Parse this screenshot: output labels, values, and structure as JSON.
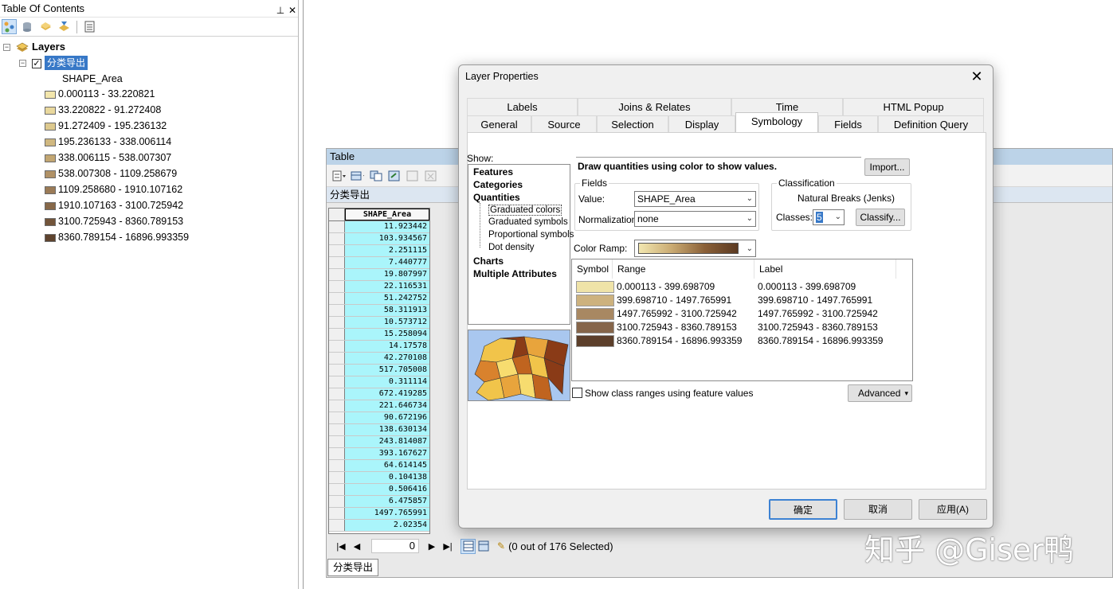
{
  "toc": {
    "title": "Table Of Contents",
    "pin_icon": "pin-icon",
    "close_icon": "close-icon",
    "tree": {
      "root_label": "Layers",
      "layer_name": "分类导出",
      "field_name": "SHAPE_Area",
      "legend": [
        {
          "label": "0.000113 - 33.220821",
          "color": "#f3e6ac"
        },
        {
          "label": "33.220822 - 91.272408",
          "color": "#e9d89d"
        },
        {
          "label": "91.272409 - 195.236132",
          "color": "#ddc98e"
        },
        {
          "label": "195.236133 - 338.006114",
          "color": "#d0b880"
        },
        {
          "label": "338.006115 - 538.007307",
          "color": "#c2a672"
        },
        {
          "label": "538.007308 - 1109.258679",
          "color": "#b09166"
        },
        {
          "label": "1109.258680 - 1910.107162",
          "color": "#9b7b57"
        },
        {
          "label": "1910.107163 - 3100.725942",
          "color": "#876849"
        },
        {
          "label": "3100.725943 - 8360.789153",
          "color": "#72543a"
        },
        {
          "label": "8360.789154 - 16896.993359",
          "color": "#5e432e"
        }
      ]
    }
  },
  "table": {
    "title": "Table",
    "layer_tab": "分类导出",
    "column_header": "SHAPE_Area",
    "rows": [
      "11.923442",
      "103.934567",
      "2.251115",
      "7.440777",
      "19.807997",
      "22.116531",
      "51.242752",
      "58.311913",
      "10.573712",
      "15.258094",
      "14.17578",
      "42.270108",
      "517.705008",
      "0.311114",
      "672.419285",
      "221.646734",
      "90.672196",
      "138.630134",
      "243.814087",
      "393.167627",
      "64.614145",
      "0.104138",
      "0.506416",
      "6.475857",
      "1497.765991",
      "2.02354"
    ],
    "record_index": "0",
    "selection_status": "(0 out of 176 Selected)",
    "bottom_tab": "分类导出"
  },
  "dialog": {
    "title": "Layer Properties",
    "tabs_row1": [
      "Labels",
      "Joins & Relates",
      "Time",
      "HTML Popup"
    ],
    "tabs_row2": [
      "General",
      "Source",
      "Selection",
      "Display",
      "Symbology",
      "Fields",
      "Definition Query"
    ],
    "active_tab": "Symbology",
    "show_label": "Show:",
    "show_items": {
      "features": "Features",
      "categories": "Categories",
      "quantities": "Quantities",
      "graduated_colors": "Graduated colors",
      "graduated_symbols": "Graduated symbols",
      "proportional_symbols": "Proportional symbols",
      "dot_density": "Dot density",
      "charts": "Charts",
      "multiple_attributes": "Multiple Attributes"
    },
    "description": "Draw quantities using color to show values.",
    "import_button": "Import...",
    "fields_group": "Fields",
    "value_label": "Value:",
    "value_selected": "SHAPE_Area",
    "normalization_label": "Normalization:",
    "normalization_selected": "none",
    "classification_group": "Classification",
    "method": "Natural Breaks (Jenks)",
    "classes_label": "Classes:",
    "classes_value": "5",
    "classify_button": "Classify...",
    "color_ramp_label": "Color Ramp:",
    "list_headers": {
      "symbol": "Symbol",
      "range": "Range",
      "label": "Label"
    },
    "classes": [
      {
        "range": "0.000113 - 399.698709",
        "label": "0.000113 - 399.698709",
        "color": "#efe3a8"
      },
      {
        "range": "399.698710 - 1497.765991",
        "label": "399.698710 - 1497.765991",
        "color": "#cdb27e"
      },
      {
        "range": "1497.765992 - 3100.725942",
        "label": "1497.765992 - 3100.725942",
        "color": "#a88862"
      },
      {
        "range": "3100.725943 - 8360.789153",
        "label": "3100.725943 - 8360.789153",
        "color": "#85654a"
      },
      {
        "range": "8360.789154 - 16896.993359",
        "label": "8360.789154 - 16896.993359",
        "color": "#5c3f2b"
      }
    ],
    "show_class_ranges_label": "Show class ranges using feature values",
    "advanced_button": "Advanced",
    "ok_button": "确定",
    "cancel_button": "取消",
    "apply_button": "应用(A)"
  },
  "watermark": "知乎 @Giser鸭"
}
